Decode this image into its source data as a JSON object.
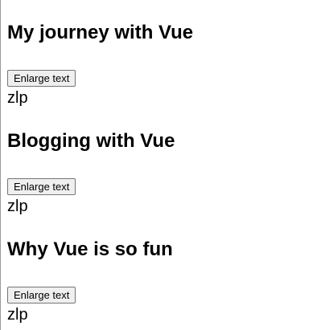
{
  "posts": [
    {
      "title": "My journey with Vue",
      "button_label": "Enlarge text",
      "content": "zlp"
    },
    {
      "title": "Blogging with Vue",
      "button_label": "Enlarge text",
      "content": "zlp"
    },
    {
      "title": "Why Vue is so fun",
      "button_label": "Enlarge text",
      "content": "zlp"
    }
  ]
}
